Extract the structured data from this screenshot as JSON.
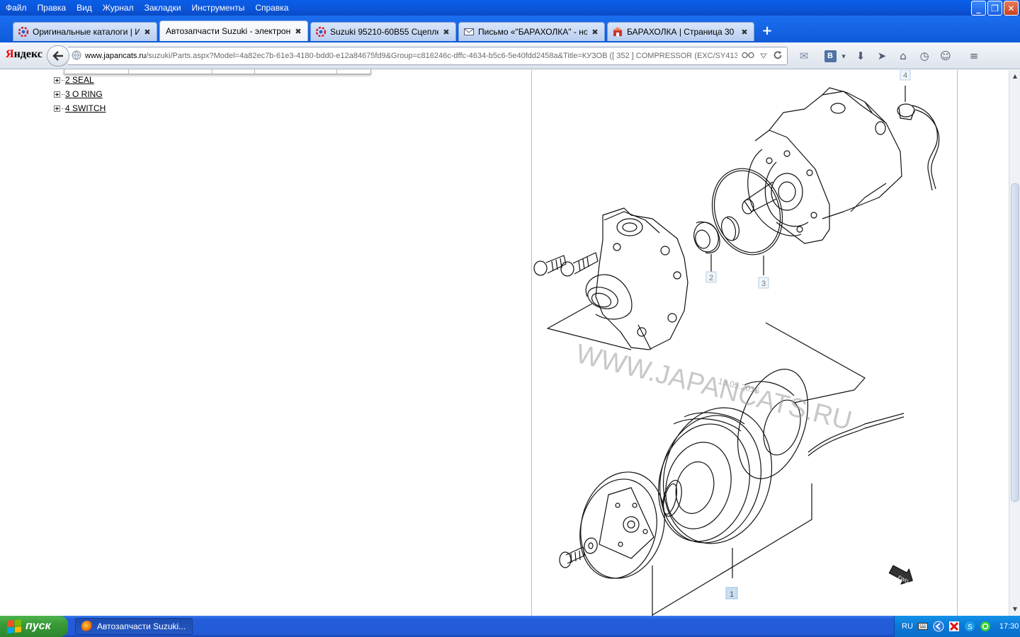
{
  "menu": [
    "Файл",
    "Правка",
    "Вид",
    "Журнал",
    "Закладки",
    "Инструменты",
    "Справка"
  ],
  "window_controls": {
    "minimize": "_",
    "restore": "❐",
    "close": "✕"
  },
  "tabs": [
    {
      "label": "Оригинальные каталоги | И...",
      "icon": "japancats-icon",
      "active": false
    },
    {
      "label": "Автозапчасти Suzuki - электрон...",
      "icon": "none",
      "active": true
    },
    {
      "label": "Suzuki 95210-60B55 Сцеплен...",
      "icon": "japancats-icon",
      "active": false
    },
    {
      "label": "Письмо «\"БАРАХОЛКА\" - нов...",
      "icon": "mail-icon",
      "active": false
    },
    {
      "label": "БАРАХОЛКА | Страница 30 |...",
      "icon": "forum-icon",
      "active": false
    }
  ],
  "tab_close_glyph": "✖",
  "new_tab_glyph": "+",
  "browser": {
    "logo_first": "Я",
    "logo_rest": "ндекс",
    "url_host": "www.japancats.ru",
    "url_path": "/suzuki/Parts.aspx?Model=4a82ec7b-61e3-4180-bdd0-e12a84675fd9&Group=c816246c-dffc-4634-b5c6-5e40fdd2458a&Title=КУЗОВ ([ 352 ]  COMPRESSOR (EXC/SY413,SY",
    "toolbar": {
      "mail": "✉",
      "vk": "B",
      "vk_dropdown": "▾",
      "download": "⬇",
      "send": "➤",
      "home": "⌂",
      "history": "◷",
      "smile": "☺",
      "menu": "≡"
    }
  },
  "parts_tree": [
    {
      "label": "2 SEAL"
    },
    {
      "label": "3 O RING"
    },
    {
      "label": "4 SWITCH"
    }
  ],
  "diagram": {
    "callouts": [
      "1",
      "2",
      "3",
      "4"
    ],
    "watermark": "WWW.JAPANCATS.RU",
    "watermark_date": "13.05.2015",
    "fwd_label": "FWD"
  },
  "taskbar": {
    "start_label": "пуск",
    "task_label": "Автозапчасти Suzuki...",
    "lang": "RU",
    "clock": "17:30"
  },
  "colors": {
    "titlebar": "#0b55d8",
    "taskbar": "#245ddb",
    "start": "#379a37",
    "tray": "#0b77d6",
    "callout_box": "#c9dff2"
  }
}
